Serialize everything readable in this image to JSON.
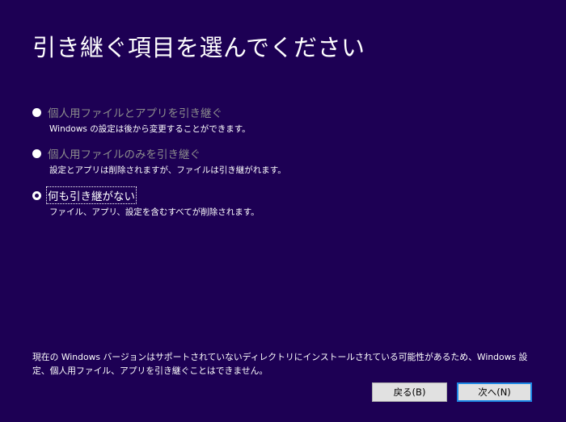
{
  "title": "引き継ぐ項目を選んでください",
  "options": [
    {
      "label": "個人用ファイルとアプリを引き継ぐ",
      "description": "Windows の設定は後から変更することができます。",
      "state": "disabled"
    },
    {
      "label": "個人用ファイルのみを引き継ぐ",
      "description": "設定とアプリは削除されますが、ファイルは引き継がれます。",
      "state": "disabled"
    },
    {
      "label": "何も引き継がない",
      "description": "ファイル、アプリ、設定を含むすべてが削除されます。",
      "state": "selected"
    }
  ],
  "footer_note": "現在の Windows バージョンはサポートされていないディレクトリにインストールされている可能性があるため、Windows 設定、個人用ファイル、アプリを引き継ぐことはできません。",
  "buttons": {
    "back": "戻る(B)",
    "next": "次へ(N)"
  },
  "colors": {
    "background": "#1d0054",
    "focus_border": "#1e88e5"
  }
}
